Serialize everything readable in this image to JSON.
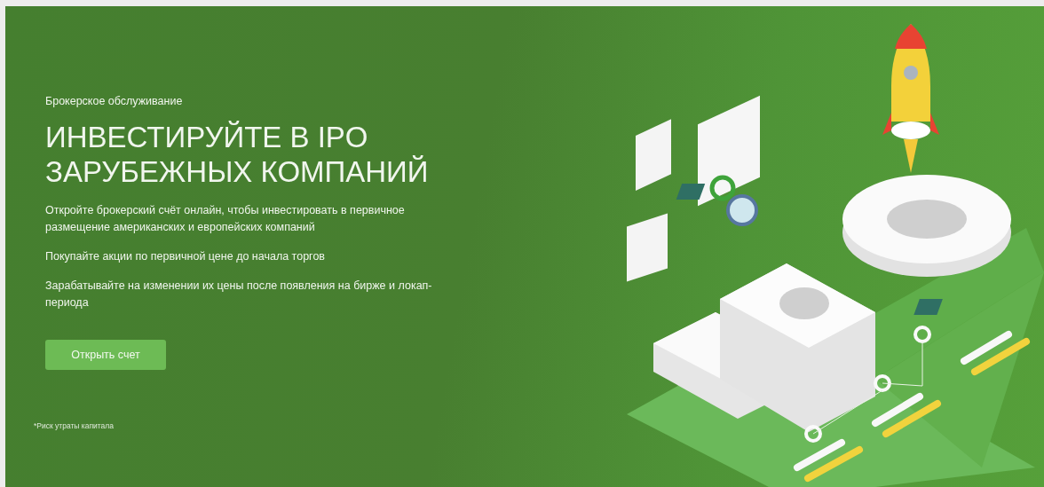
{
  "banner": {
    "eyebrow": "Брокерское обслуживание",
    "title_lines": [
      "ИНВЕСТИРУЙТЕ В IPO",
      "ЗАРУБЕЖНЫХ КОМПАНИЙ"
    ],
    "paragraphs": [
      "Откройте брокерский счёт онлайн, чтобы инвестировать в первичное размещение американских и европейских компаний",
      "Покупайте акции по первичной цене до начала торгов",
      "Зарабатывайте на изменении их цены после появления на бирже и локап-периода"
    ],
    "button": "Открыть счет",
    "footnote": "*Риск утраты капитала"
  }
}
